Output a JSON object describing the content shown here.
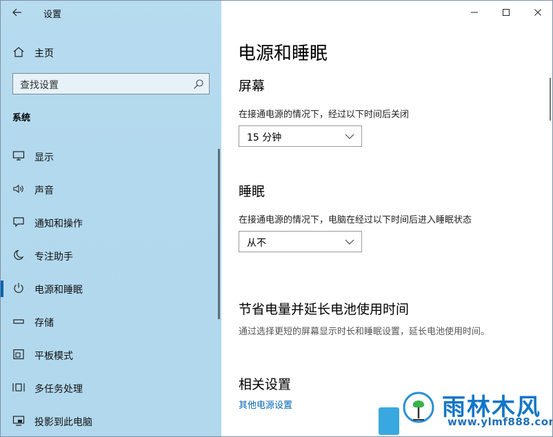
{
  "window": {
    "title": "设置"
  },
  "sidebar": {
    "home_label": "主页",
    "search_placeholder": "查找设置",
    "section_label": "系统",
    "items": [
      {
        "label": "显示",
        "icon": "monitor-icon"
      },
      {
        "label": "声音",
        "icon": "speaker-icon"
      },
      {
        "label": "通知和操作",
        "icon": "notification-icon"
      },
      {
        "label": "专注助手",
        "icon": "moon-icon"
      },
      {
        "label": "电源和睡眠",
        "icon": "power-icon",
        "active": true
      },
      {
        "label": "存储",
        "icon": "storage-icon"
      },
      {
        "label": "平板模式",
        "icon": "tablet-icon"
      },
      {
        "label": "多任务处理",
        "icon": "multitask-icon"
      },
      {
        "label": "投影到此电脑",
        "icon": "project-icon"
      }
    ]
  },
  "main": {
    "title": "电源和睡眠",
    "screen": {
      "heading": "屏幕",
      "description": "在接通电源的情况下，经过以下时间后关闭",
      "value": "15 分钟"
    },
    "sleep": {
      "heading": "睡眠",
      "description": "在接通电源的情况下，电脑在经过以下时间后进入睡眠状态",
      "value": "从不"
    },
    "save_power": {
      "heading": "节省电量并延长电池使用时间",
      "description": "通过选择更短的屏幕显示时长和睡眠设置，延长电池使用时间。"
    },
    "related": {
      "heading": "相关设置",
      "link": "其他电源设置"
    }
  },
  "watermark": {
    "text": "雨林木风",
    "url": "www.ylmf888.com"
  },
  "colors": {
    "accent": "#0063b1",
    "link": "#0066b4",
    "sidebar_bg": "#b3d9ee"
  }
}
